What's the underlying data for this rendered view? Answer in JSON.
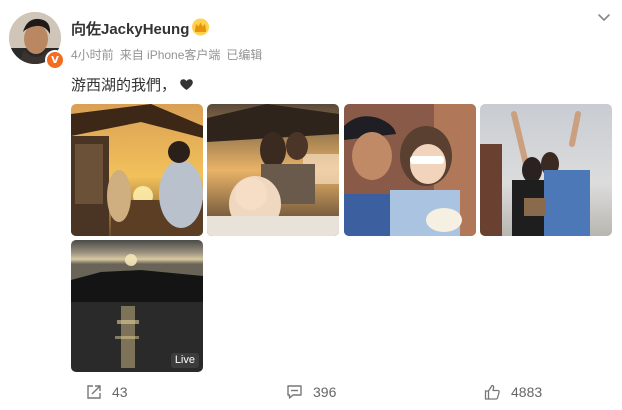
{
  "post": {
    "author": {
      "name": "向佐JackyHeung",
      "verified_badge": "V"
    },
    "meta": {
      "time": "4小时前",
      "source": "来自 iPhone客户端",
      "edited": "已编辑"
    },
    "text": "游西湖的我們，",
    "live_label": "Live"
  },
  "actions": {
    "share_count": "43",
    "comment_count": "396",
    "like_count": "4883"
  },
  "colors": {
    "badge": "#f36c21",
    "meta_gray": "#939393",
    "text": "#333333"
  }
}
